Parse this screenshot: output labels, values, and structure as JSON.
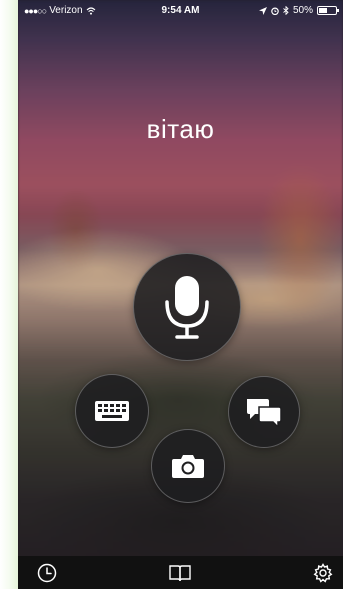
{
  "status_bar": {
    "signal_dots": "●●●○○",
    "carrier": "Verizon",
    "time": "9:54 AM",
    "battery_percent": "50%",
    "battery_level": 0.5,
    "icons": [
      "wifi-icon",
      "location-arrow-icon",
      "alarm-icon",
      "bluetooth-icon",
      "battery-icon"
    ]
  },
  "main": {
    "greeting": "вітаю"
  },
  "actions": {
    "microphone": {
      "icon": "microphone-icon"
    },
    "keyboard": {
      "icon": "keyboard-icon"
    },
    "conversation": {
      "icon": "speech-bubbles-icon"
    },
    "camera": {
      "icon": "camera-icon"
    }
  },
  "bottom_bar": {
    "tabs": [
      {
        "icon": "clock-icon"
      },
      {
        "icon": "book-icon"
      },
      {
        "icon": "gear-icon"
      }
    ]
  },
  "colors": {
    "button_fill": "#1e1e20",
    "bottom_bar": "#111111",
    "text": "#ffffff"
  }
}
